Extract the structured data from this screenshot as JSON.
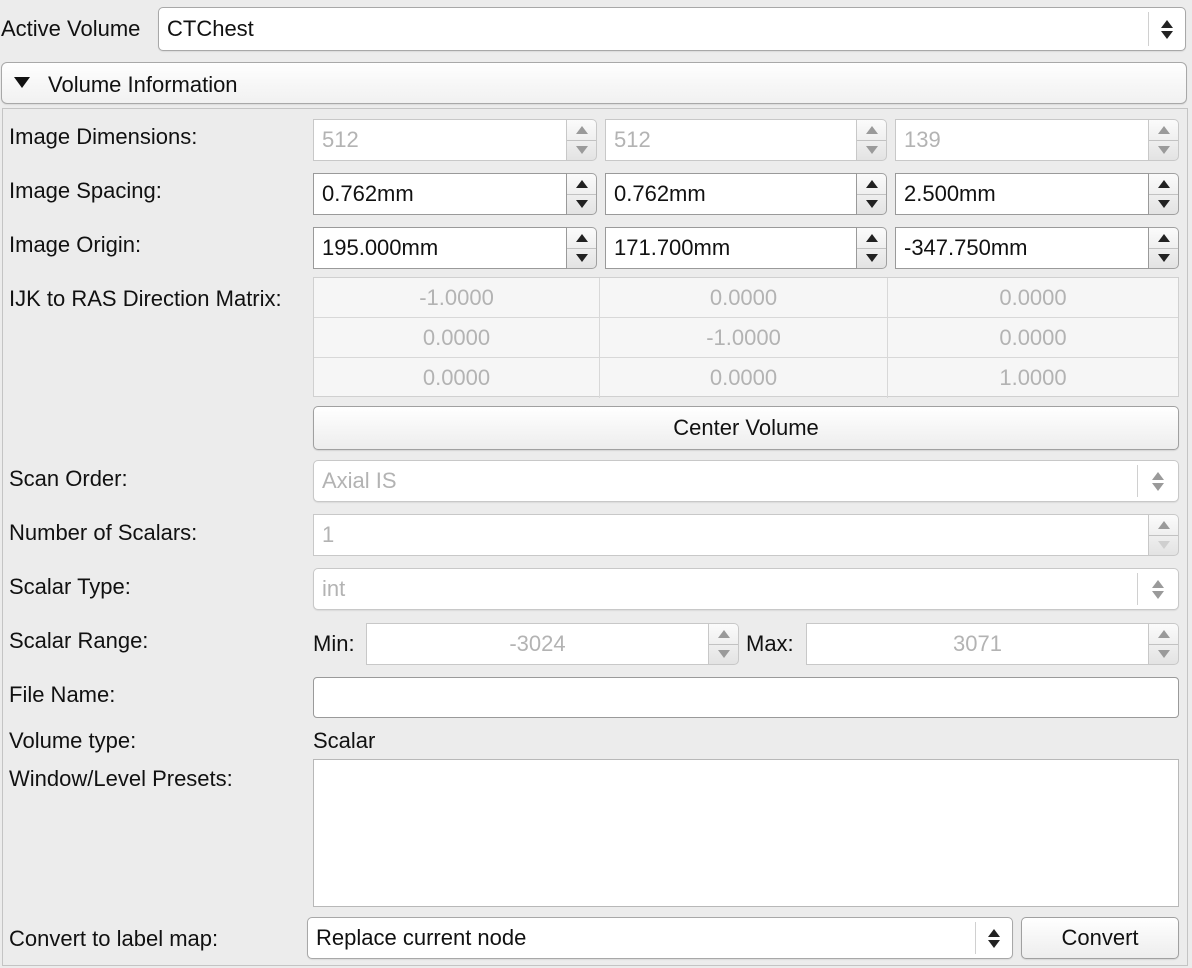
{
  "active_volume": {
    "label": "Active Volume",
    "value": "CTChest"
  },
  "section": {
    "title": "Volume Information"
  },
  "fields": {
    "image_dimensions": {
      "label": "Image Dimensions:",
      "values": [
        "512",
        "512",
        "139"
      ]
    },
    "image_spacing": {
      "label": "Image Spacing:",
      "values": [
        "0.762mm",
        "0.762mm",
        "2.500mm"
      ]
    },
    "image_origin": {
      "label": "Image Origin:",
      "values": [
        "195.000mm",
        "171.700mm",
        "-347.750mm"
      ]
    },
    "direction_matrix": {
      "label": "IJK to RAS Direction Matrix:",
      "rows": [
        [
          "-1.0000",
          "0.0000",
          "0.0000"
        ],
        [
          "0.0000",
          "-1.0000",
          "0.0000"
        ],
        [
          "0.0000",
          "0.0000",
          "1.0000"
        ]
      ]
    },
    "center_volume": {
      "label": "Center Volume"
    },
    "scan_order": {
      "label": "Scan Order:",
      "value": "Axial IS"
    },
    "number_of_scalars": {
      "label": "Number of Scalars:",
      "value": "1"
    },
    "scalar_type": {
      "label": "Scalar Type:",
      "value": "int"
    },
    "scalar_range": {
      "label": "Scalar Range:",
      "min_label": "Min:",
      "min": "-3024",
      "max_label": "Max:",
      "max": "3071"
    },
    "file_name": {
      "label": "File Name:",
      "value": ""
    },
    "volume_type": {
      "label": "Volume type:",
      "value": "Scalar"
    },
    "window_level_presets": {
      "label": "Window/Level Presets:"
    },
    "convert": {
      "label": "Convert to label map:",
      "option": "Replace current node",
      "button": "Convert"
    }
  }
}
